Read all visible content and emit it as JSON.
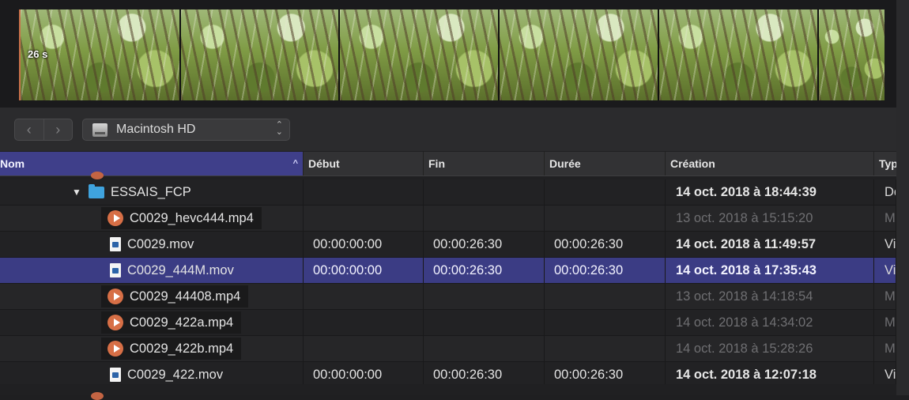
{
  "filmstrip": {
    "duration_badge": "26 s",
    "frame_count": 6
  },
  "toolbar": {
    "back_icon": "chevron-left-icon",
    "forward_icon": "chevron-right-icon",
    "volume": "Macintosh HD",
    "volume_icon": "hard-drive-icon",
    "updown_icon": "up-down-chevron-icon"
  },
  "columns": {
    "nom": "Nom",
    "debut": "Début",
    "fin": "Fin",
    "duree": "Durée",
    "creation": "Création",
    "type": "Typ"
  },
  "rows": [
    {
      "name": "ESSAIS_FCP",
      "icon": "folder-icon",
      "debut": "",
      "fin": "",
      "duree": "",
      "creation": "14 oct. 2018 à 18:44:39",
      "type": "Do"
    },
    {
      "name": "C0029_hevc444.mp4",
      "icon": "play-icon",
      "debut": "",
      "fin": "",
      "duree": "",
      "creation": "13 oct. 2018 à 15:15:20",
      "type": "M"
    },
    {
      "name": "C0029.mov",
      "icon": "movie-file-icon",
      "debut": "00:00:00:00",
      "fin": "00:00:26:30",
      "duree": "00:00:26:30",
      "creation": "14 oct. 2018 à 11:49:57",
      "type": "Vi"
    },
    {
      "name": "C0029_444M.mov",
      "icon": "movie-file-icon",
      "debut": "00:00:00:00",
      "fin": "00:00:26:30",
      "duree": "00:00:26:30",
      "creation": "14 oct. 2018 à 17:35:43",
      "type": "Vi"
    },
    {
      "name": "C0029_44408.mp4",
      "icon": "play-icon",
      "debut": "",
      "fin": "",
      "duree": "",
      "creation": "13 oct. 2018 à 14:18:54",
      "type": "M"
    },
    {
      "name": "C0029_422a.mp4",
      "icon": "play-icon",
      "debut": "",
      "fin": "",
      "duree": "",
      "creation": "14 oct. 2018 à 14:34:02",
      "type": "M"
    },
    {
      "name": "C0029_422b.mp4",
      "icon": "play-icon",
      "debut": "",
      "fin": "",
      "duree": "",
      "creation": "14 oct. 2018 à 15:28:26",
      "type": "M"
    },
    {
      "name": "C0029_422.mov",
      "icon": "movie-file-icon",
      "debut": "00:00:00:00",
      "fin": "00:00:26:30",
      "duree": "00:00:26:30",
      "creation": "14 oct. 2018 à 12:07:18",
      "type": "Vi"
    }
  ],
  "colors": {
    "selection": "#3b3c84",
    "sorted_header": "#3f3f8a",
    "folder": "#3fa3de",
    "play_badge": "#d76f46"
  }
}
